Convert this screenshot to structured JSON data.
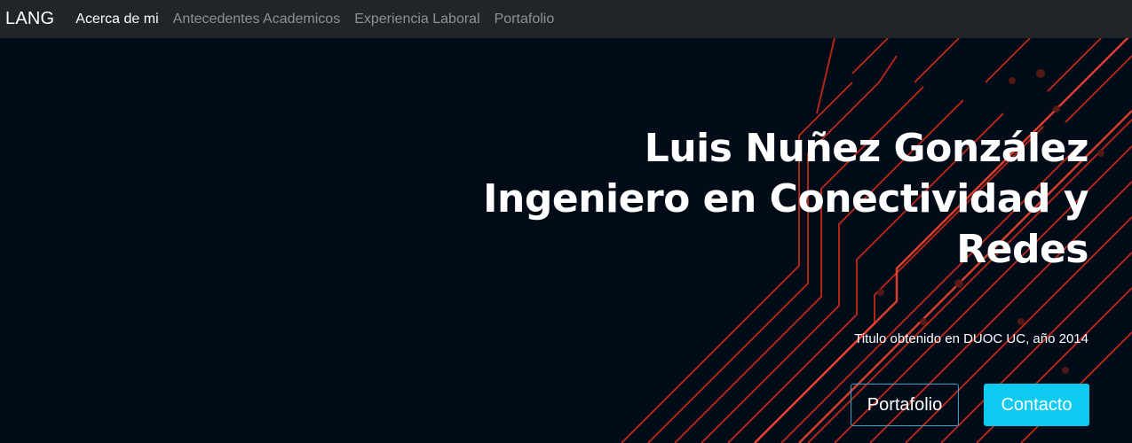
{
  "navbar": {
    "brand": "LANG",
    "items": [
      {
        "label": "Acerca de mi",
        "active": true
      },
      {
        "label": "Antecedentes Academicos",
        "active": false
      },
      {
        "label": "Experiencia Laboral",
        "active": false
      },
      {
        "label": "Portafolio",
        "active": false
      }
    ]
  },
  "hero": {
    "title_line1": "Luis Nuñez González",
    "title_line2": "Ingeniero en Conectividad y",
    "title_line3": "Redes",
    "subtitle": "Titulo obtenido en DUOC UC, año 2014",
    "buttons": {
      "portfolio": "Portafolio",
      "contact": "Contacto"
    }
  },
  "colors": {
    "background": "#020b18",
    "navbar": "#212529",
    "circuit_lines": "#d8321f",
    "button_info": "#0dcaf0",
    "button_outline_border": "#35a4c7"
  }
}
